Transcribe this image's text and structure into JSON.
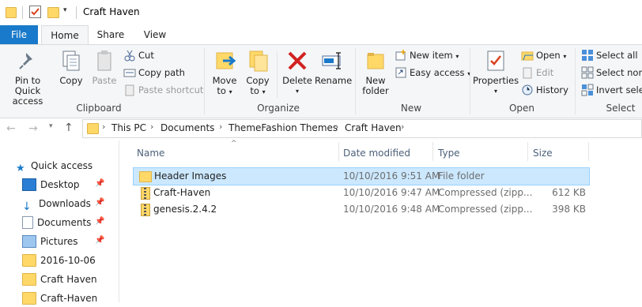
{
  "window": {
    "title": "Craft Haven"
  },
  "tabs": {
    "file": "File",
    "home": "Home",
    "share": "Share",
    "view": "View"
  },
  "ribbon": {
    "clipboard": {
      "label": "Clipboard",
      "pin_line1": "Pin to Quick",
      "pin_line2": "access",
      "copy": "Copy",
      "paste": "Paste",
      "cut": "Cut",
      "copy_path": "Copy path",
      "paste_shortcut": "Paste shortcut"
    },
    "organize": {
      "label": "Organize",
      "move_line1": "Move",
      "move_line2": "to",
      "copy_line1": "Copy",
      "copy_line2": "to",
      "delete": "Delete",
      "rename": "Rename"
    },
    "new": {
      "label": "New",
      "new_folder_line1": "New",
      "new_folder_line2": "folder",
      "new_item": "New item",
      "easy_access": "Easy access"
    },
    "open": {
      "label": "Open",
      "properties": "Properties",
      "open": "Open",
      "edit": "Edit",
      "history": "History"
    },
    "select": {
      "label": "Select",
      "select_all": "Select all",
      "select_none": "Select none",
      "invert_selection": "Invert selec"
    }
  },
  "address": {
    "crumbs": [
      "This PC",
      "Documents",
      "ThemeFashion Themes",
      "Craft Haven"
    ]
  },
  "navpane": {
    "quick_access": "Quick access",
    "items": [
      "Desktop",
      "Downloads",
      "Documents",
      "Pictures",
      "2016-10-06",
      "Craft Haven",
      "Craft-Haven"
    ]
  },
  "columns": {
    "name": "Name",
    "date": "Date modified",
    "type": "Type",
    "size": "Size"
  },
  "files": [
    {
      "name": "Header Images",
      "date": "10/10/2016 9:51 AM",
      "type": "File folder",
      "size": ""
    },
    {
      "name": "Craft-Haven",
      "date": "10/10/2016 9:47 AM",
      "type": "Compressed (zipp...",
      "size": "612 KB"
    },
    {
      "name": "genesis.2.4.2",
      "date": "10/10/2016 9:48 AM",
      "type": "Compressed (zipp...",
      "size": "398 KB"
    }
  ],
  "colors": {
    "accent": "#1979ca",
    "selection": "#cce8ff",
    "folder": "#ffd868"
  }
}
